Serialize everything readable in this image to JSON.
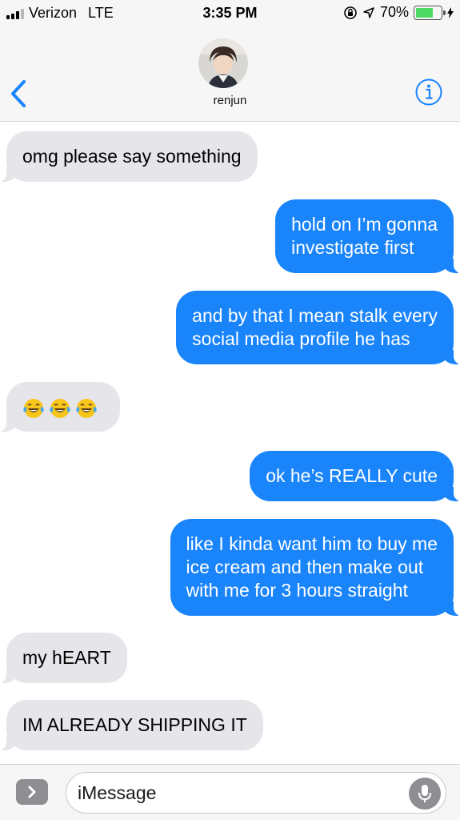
{
  "status": {
    "carrier": "Verizon",
    "network": "LTE",
    "time": "3:35 PM",
    "battery_percent": "70%",
    "battery_level": 0.7
  },
  "contact": {
    "name": "renjun"
  },
  "messages": [
    {
      "direction": "received",
      "lines": [
        "omg please say something"
      ]
    },
    {
      "direction": "sent",
      "lines": [
        "hold on I’m gonna",
        "investigate first"
      ]
    },
    {
      "direction": "sent",
      "lines": [
        "and by that I mean stalk every",
        "social media profile he has"
      ]
    },
    {
      "direction": "received",
      "emoji": [
        "face-with-tears-of-joy",
        "face-with-tears-of-joy",
        "face-with-tears-of-joy"
      ]
    },
    {
      "direction": "sent",
      "lines": [
        "ok he’s REALLY cute"
      ]
    },
    {
      "direction": "sent",
      "lines": [
        "like I kinda want him to buy me",
        "ice cream and then make out",
        "with me for 3 hours straight"
      ]
    },
    {
      "direction": "received",
      "lines": [
        "my hEART"
      ]
    },
    {
      "direction": "received",
      "lines": [
        "IM ALREADY SHIPPING IT"
      ]
    }
  ],
  "composer": {
    "placeholder": "iMessage"
  },
  "icons": {
    "back": "chevron-left-icon",
    "info": "info-icon",
    "apps": "chevron-right-icon",
    "mic": "microphone-icon",
    "orientation_lock": "orientation-lock-icon",
    "location": "location-arrow-icon",
    "charging": "bolt-icon"
  },
  "colors": {
    "sent_bubble": "#1a84fb",
    "received_bubble": "#e5e5ea",
    "accent": "#1a84fb",
    "battery": "#4cd964"
  }
}
